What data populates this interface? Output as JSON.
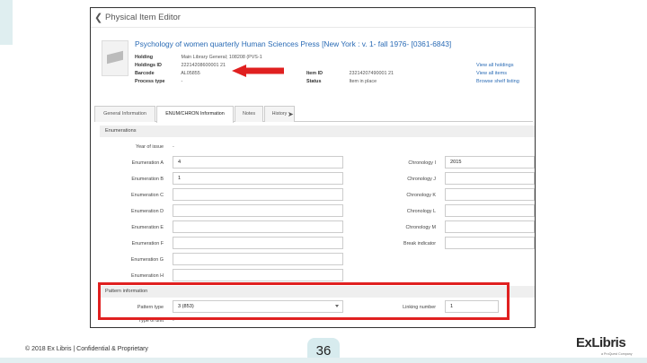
{
  "editor": {
    "back_symbol": "❮",
    "title": "Physical Item Editor"
  },
  "record": {
    "title": "Psychology of women quarterly Human Sciences Press [New York : v. 1- fall 1976- [0361-6843]"
  },
  "meta": {
    "holding_label": "Holding",
    "holding_value": "Main Library General; 108208 (PVS-1",
    "holdings_id_label": "Holdings ID",
    "holdings_id_value": "22214208600001 21",
    "barcode_label": "Barcode",
    "barcode_value": "AL05855",
    "process_type_label": "Process type",
    "process_type_value": "-",
    "item_id_label": "Item ID",
    "item_id_value": "23214207490001 21",
    "status_label": "Status",
    "status_value": "Item in place"
  },
  "links": {
    "view_holdings": "View all holdings",
    "view_items": "View all items",
    "browse_shelf": "Browse shelf listing"
  },
  "tabs": [
    "General Information",
    "ENUM/CHRON Information",
    "Notes",
    "History"
  ],
  "enumerations": {
    "section_title": "Enumerations",
    "year_of_issue_label": "Year of issue",
    "year_of_issue_value": "-",
    "left_fields": [
      {
        "label": "Enumeration A",
        "value": "4"
      },
      {
        "label": "Enumeration B",
        "value": "1"
      },
      {
        "label": "Enumeration C",
        "value": ""
      },
      {
        "label": "Enumeration D",
        "value": ""
      },
      {
        "label": "Enumeration E",
        "value": ""
      },
      {
        "label": "Enumeration F",
        "value": ""
      },
      {
        "label": "Enumeration G",
        "value": ""
      },
      {
        "label": "Enumeration H",
        "value": ""
      }
    ],
    "right_fields": [
      {
        "label": "Chronology I",
        "value": "2015"
      },
      {
        "label": "Chronology J",
        "value": ""
      },
      {
        "label": "Chronology K",
        "value": ""
      },
      {
        "label": "Chronology L",
        "value": ""
      },
      {
        "label": "Chronology M",
        "value": ""
      },
      {
        "label": "Break indicator",
        "value": ""
      }
    ]
  },
  "pattern": {
    "section_title": "Pattern information",
    "pattern_type_label": "Pattern type",
    "pattern_type_value": "3 (853)",
    "linking_number_label": "Linking number",
    "linking_number_value": "1",
    "type_label": "Type of unit",
    "type_value": "-"
  },
  "footer": {
    "copyright": "© 2018 Ex Libris | Confidential & Proprietary",
    "page_number": "36"
  },
  "logo": {
    "text": "ExLibris",
    "subtitle": "a ProQuest Company"
  },
  "colors": {
    "link": "#2a6bb5",
    "highlight": "#e02020",
    "accent_tab": "#d7ebee"
  }
}
